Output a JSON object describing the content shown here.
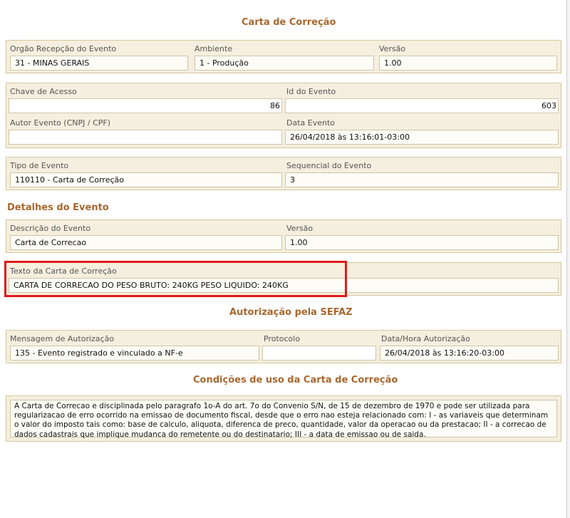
{
  "titles": {
    "carta": "Carta de Correção",
    "detalhes": "Detalhes do Evento",
    "autorizacao": "Autorização pela SEFAZ",
    "condicoes": "Condições de uso da Carta de Correção"
  },
  "evento": {
    "orgao_label": "Orgão Recepção do Evento",
    "orgao_value": "31 - MINAS GERAIS",
    "ambiente_label": "Ambiente",
    "ambiente_value": "1 - Produção",
    "versao_label": "Versão",
    "versao_value": "1.00"
  },
  "chave": {
    "chave_label": "Chave de Acesso",
    "chave_value": "86",
    "id_label": "Id do Evento",
    "id_value": "603",
    "autor_label": "Autor Evento (CNPJ / CPF)",
    "autor_value": "",
    "data_label": "Data Evento",
    "data_value": "26/04/2018 às 13:16:01-03:00"
  },
  "tipo": {
    "tipo_label": "Tipo de Evento",
    "tipo_value": "110110 - Carta de Correção",
    "seq_label": "Sequencial do Evento",
    "seq_value": "3"
  },
  "detalhes": {
    "descricao_label": "Descrição do Evento",
    "descricao_value": "Carta de Correcao",
    "versao_label": "Versão",
    "versao_value": "1.00"
  },
  "texto": {
    "label": "Texto da Carta de Correção",
    "value": "CARTA DE CORRECAO DO PESO BRUTO: 240KG PESO LIQUIDO: 240KG"
  },
  "autorizacao": {
    "mensagem_label": "Mensagem de Autorização",
    "mensagem_value": "135 - Evento registrado e vinculado a NF-e",
    "protocolo_label": "Protocolo",
    "protocolo_value": "",
    "datahora_label": "Data/Hora Autorização",
    "datahora_value": "26/04/2018 às 13:16:20-03:00"
  },
  "condicoes": {
    "text": "A Carta de Correcao e disciplinada pelo paragrafo 1o-A do art. 7o do Convenio S/N, de 15 de dezembro de 1970 e pode ser utilizada para regularizacao de erro ocorrido na emissao de documento fiscal, desde que o erro nao esteja relacionado com: I - as variaveis que determinam o valor do imposto tais como: base de calculo, aliquota, diferenca de preco, quantidade, valor da operacao ou da prestacao; II - a correcao de dados cadastrais que implique mudanca do remetente ou do destinatario; III - a data de emissao ou de saida."
  },
  "colors": {
    "title": "#a8672e",
    "panel": "#f5efdf",
    "panel_border": "#d6c79d",
    "highlight": "#e01a1a"
  }
}
